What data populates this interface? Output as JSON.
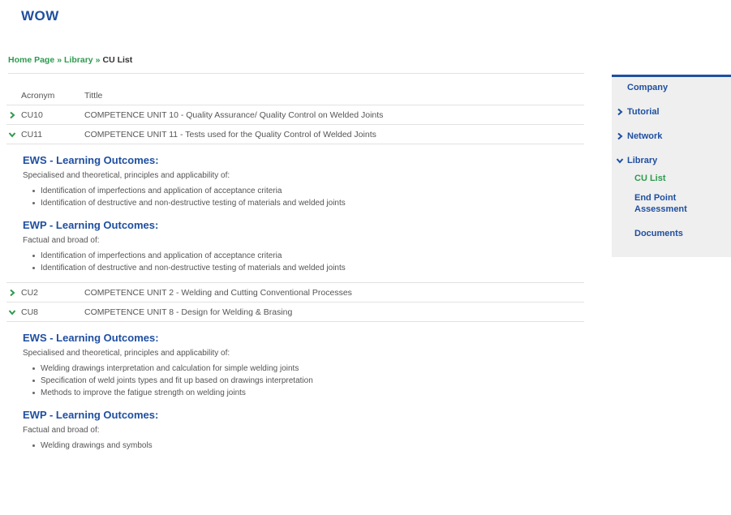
{
  "site": {
    "logo": "WOW"
  },
  "breadcrumb": [
    {
      "label": "Home Page",
      "link": true
    },
    {
      "label": "Library",
      "link": true
    },
    {
      "label": "CU List",
      "link": false
    }
  ],
  "breadcrumb_sep": "»",
  "table": {
    "headers": {
      "acronym": "Acronym",
      "title": "Tittle"
    },
    "rows": [
      {
        "acronym": "CU10",
        "title": "COMPETENCE UNIT 10 - Quality Assurance/ Quality Control on Welded Joints",
        "expanded": false
      },
      {
        "acronym": "CU11",
        "title": "COMPETENCE UNIT 11 - Tests used for the Quality Control of Welded Joints",
        "expanded": true,
        "sections": [
          {
            "heading": "EWS - Learning Outcomes:",
            "intro": "Specialised and theoretical, principles and applicability of:",
            "items": [
              "Identification of imperfections and application of acceptance criteria",
              "Identification of destructive and non-destructive testing of materials and welded joints"
            ]
          },
          {
            "heading": "EWP - Learning Outcomes:",
            "intro": "Factual and broad of:",
            "items": [
              "Identification of imperfections and application of acceptance criteria",
              "Identification of destructive and non-destructive testing of materials and welded joints"
            ]
          }
        ]
      },
      {
        "acronym": "CU2",
        "title": "COMPETENCE UNIT 2 - Welding and Cutting Conventional Processes",
        "expanded": false
      },
      {
        "acronym": "CU8",
        "title": "COMPETENCE UNIT 8 - Design for Welding & Brasing",
        "expanded": true,
        "sections": [
          {
            "heading": "EWS - Learning Outcomes:",
            "intro": "Specialised and theoretical, principles and applicability of:",
            "items": [
              "Welding drawings interpretation and calculation for simple welding joints",
              "Specification of weld joints types and fit up based on drawings interpretation",
              "Methods to improve the fatigue strength on welding joints"
            ]
          },
          {
            "heading": "EWP - Learning Outcomes:",
            "intro": "Factual and broad of:",
            "items": [
              "Welding drawings and symbols"
            ]
          }
        ]
      }
    ]
  },
  "sidebar": {
    "items": [
      {
        "label": "Company",
        "icon": "none"
      },
      {
        "label": "Tutorial",
        "icon": "chevron-right-icon"
      },
      {
        "label": "Network",
        "icon": "chevron-right-icon"
      },
      {
        "label": "Library",
        "icon": "chevron-down-icon"
      }
    ],
    "sub_items": [
      {
        "label": "CU List",
        "active": true
      },
      {
        "label": "End Point Assessment",
        "active": false
      },
      {
        "label": "Documents",
        "active": false
      }
    ]
  },
  "colors": {
    "brand_blue": "#1f4fa0",
    "accent_green": "#2e9a4e",
    "sidebar_bg": "#efefef"
  }
}
